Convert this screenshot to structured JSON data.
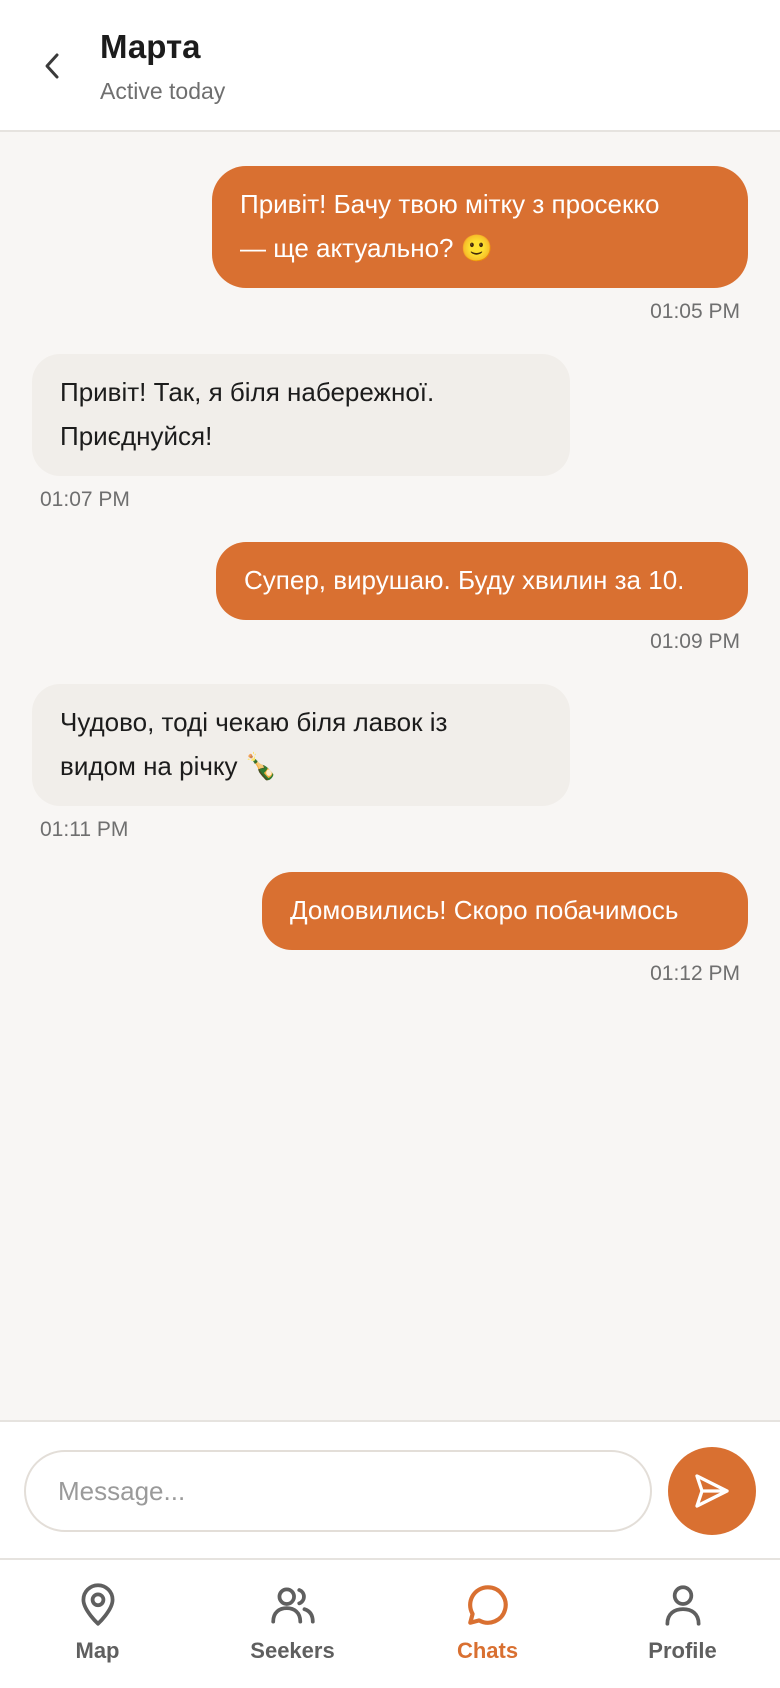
{
  "header": {
    "contact_name": "Марта",
    "status": "Active today"
  },
  "messages": [
    {
      "direction": "outgoing",
      "text_lines": [
        "Привіт! Бачу твою мітку з просекко",
        "— ще актуально? 🙂"
      ],
      "time": "01:05 PM"
    },
    {
      "direction": "incoming",
      "text_lines": [
        "Привіт! Так, я біля набережної.",
        "Приєднуйся!"
      ],
      "time": "01:07 PM"
    },
    {
      "direction": "outgoing",
      "text_lines": [
        "Супер, вирушаю. Буду хвилин за 10."
      ],
      "time": "01:09 PM"
    },
    {
      "direction": "incoming",
      "text_lines": [
        "Чудово, тоді чекаю біля лавок із",
        "видом на річку 🍾"
      ],
      "time": "01:11 PM"
    },
    {
      "direction": "outgoing",
      "text_lines": [
        "Домовились! Скоро побачимось"
      ],
      "time": "01:12 PM"
    }
  ],
  "composer": {
    "placeholder": "Message...",
    "value": ""
  },
  "tabs": [
    {
      "label": "Map",
      "icon": "map-pin-icon",
      "active": false
    },
    {
      "label": "Seekers",
      "icon": "users-icon",
      "active": false
    },
    {
      "label": "Chats",
      "icon": "chat-bubble-icon",
      "active": true
    },
    {
      "label": "Profile",
      "icon": "user-icon",
      "active": false
    }
  ],
  "colors": {
    "accent": "#d97031",
    "incoming_bubble": "#f1eeea",
    "background": "#f8f6f4",
    "inactive_tab": "#5f5f5f"
  }
}
